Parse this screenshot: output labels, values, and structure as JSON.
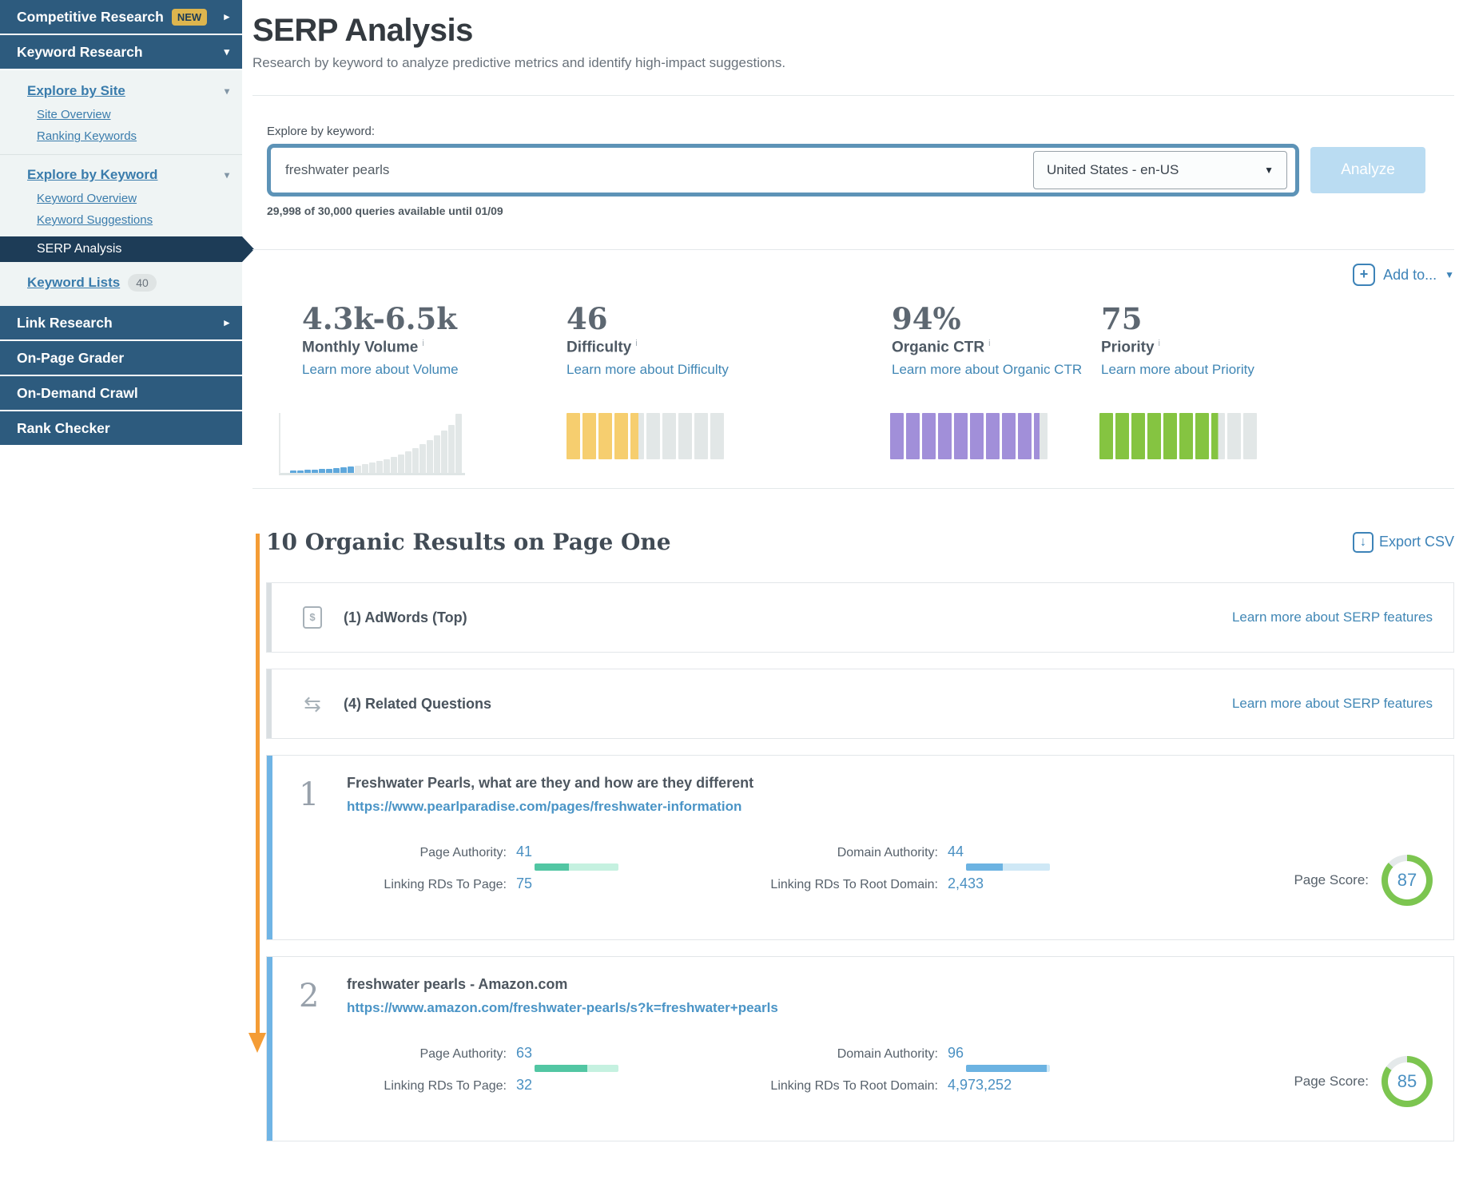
{
  "sidebar": {
    "competitive_research": "Competitive Research",
    "new_badge": "NEW",
    "keyword_research": "Keyword Research",
    "explore_by_site": "Explore by Site",
    "site_overview": "Site Overview",
    "ranking_keywords": "Ranking Keywords",
    "explore_by_keyword": "Explore by Keyword",
    "keyword_overview": "Keyword Overview",
    "keyword_suggestions": "Keyword Suggestions",
    "serp_analysis": "SERP Analysis",
    "keyword_lists": "Keyword Lists",
    "keyword_lists_count": "40",
    "link_research": "Link Research",
    "on_page_grader": "On-Page Grader",
    "on_demand_crawl": "On-Demand Crawl",
    "rank_checker": "Rank Checker"
  },
  "header": {
    "title": "SERP Analysis",
    "subtitle": "Research by keyword to analyze predictive metrics and identify high-impact suggestions."
  },
  "search": {
    "label": "Explore by keyword:",
    "keyword": "freshwater pearls",
    "locale": "United States - en-US",
    "analyze_label": "Analyze",
    "quota": "29,998 of 30,000 queries available until 01/09"
  },
  "add_to_label": "Add to...",
  "metrics": {
    "items": [
      {
        "value": "4.3k-6.5k",
        "label": "Monthly Volume",
        "link": "Learn more about Volume"
      },
      {
        "value": "46",
        "label": "Difficulty",
        "link": "Learn more about Difficulty"
      },
      {
        "value": "94%",
        "label": "Organic CTR",
        "link": "Learn more about Organic CTR"
      },
      {
        "value": "75",
        "label": "Priority",
        "link": "Learn more about Priority"
      }
    ]
  },
  "chart_data": {
    "volume_histogram": {
      "type": "bar",
      "heights": [
        3,
        3,
        4,
        4,
        5,
        5,
        6,
        7,
        8,
        9,
        11,
        13,
        15,
        17,
        20,
        23,
        27,
        31,
        36,
        41,
        47,
        53,
        60,
        74
      ],
      "highlighted_bars": 9,
      "highlight_color": "#5fa8dc",
      "bar_color": "#e2e7e7",
      "note": "monthly volume distribution, selected range 4.3k-6.5k"
    },
    "difficulty_meter": {
      "type": "bar",
      "segments": 10,
      "filled": 4.6,
      "value": 46,
      "color": "#f6ce6f",
      "track": "#e2e7e7"
    },
    "organic_ctr_meter": {
      "type": "bar",
      "segments": 10,
      "filled": 9.4,
      "value": 94,
      "color": "#a18fd9",
      "track": "#e2e7e7"
    },
    "priority_meter": {
      "type": "bar",
      "segments": 10,
      "filled": 7.5,
      "value": 75,
      "color": "#85c441",
      "track": "#e2e7e7"
    }
  },
  "results": {
    "heading": "10 Organic Results on Page One",
    "export_label": "Export CSV",
    "serp_features_link": "Learn more about SERP features",
    "features": [
      {
        "label": "(1) AdWords (Top)"
      },
      {
        "label": "(4) Related Questions"
      }
    ],
    "labels": {
      "page_authority": "Page Authority:",
      "linking_rds_page": "Linking RDs To Page:",
      "domain_authority": "Domain Authority:",
      "linking_rds_root": "Linking RDs To Root Domain:",
      "page_score": "Page Score:"
    },
    "gauge_color": "#7cc550",
    "gauge_track": "#e4e9ea",
    "items": [
      {
        "rank": "1",
        "title": "Freshwater Pearls, what are they and how are they different",
        "url": "https://www.pearlparadise.com/pages/freshwater-information",
        "page_authority": 41,
        "linking_rds_to_page": "75",
        "domain_authority": 44,
        "linking_rds_to_root_domain": "2,433",
        "page_score": 87
      },
      {
        "rank": "2",
        "title": "freshwater pearls - Amazon.com",
        "url": "https://www.amazon.com/freshwater-pearls/s?k=freshwater+pearls",
        "page_authority": 63,
        "linking_rds_to_page": "32",
        "domain_authority": 96,
        "linking_rds_to_root_domain": "4,973,252",
        "page_score": 85
      }
    ]
  }
}
